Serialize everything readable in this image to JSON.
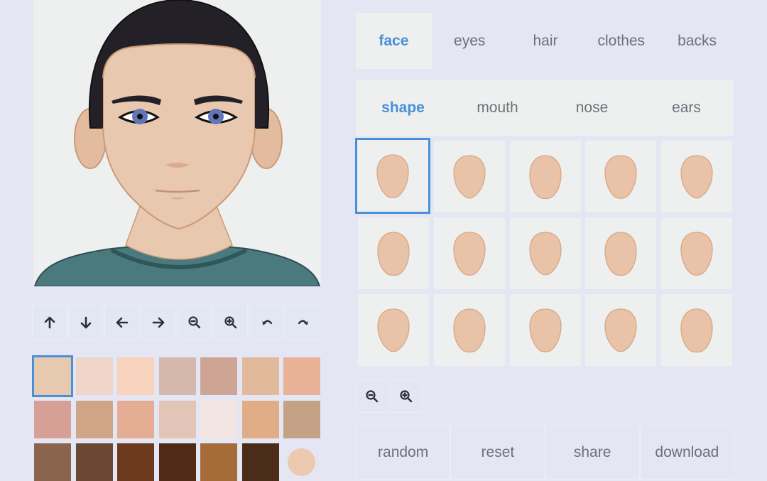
{
  "avatar": {
    "skin_color": "#e8c8ae",
    "hair_color": "#232027",
    "eye_color": "#6176b8",
    "shirt_color": "#4b7a7e",
    "background_color": "#eef0f0"
  },
  "toolbar": [
    {
      "name": "move-up",
      "icon": "arrow-up-icon"
    },
    {
      "name": "move-down",
      "icon": "arrow-down-icon"
    },
    {
      "name": "move-left",
      "icon": "arrow-left-icon"
    },
    {
      "name": "move-right",
      "icon": "arrow-right-icon"
    },
    {
      "name": "zoom-out",
      "icon": "zoom-out-icon"
    },
    {
      "name": "zoom-in",
      "icon": "zoom-in-icon"
    },
    {
      "name": "undo",
      "icon": "undo-icon"
    },
    {
      "name": "redo",
      "icon": "redo-icon"
    }
  ],
  "skin_swatches": {
    "selected_index": 0,
    "colors": [
      "#e7c9af",
      "#efd4ca",
      "#f7d2bc",
      "#d4b8ac",
      "#cea595",
      "#e0ba9a",
      "#e9b195",
      "#d6a097",
      "#cfa487",
      "#e6ad95",
      "#e3c5b8",
      "#f2e5e2",
      "#e1ad87",
      "#c4a286",
      "#8b644e",
      "#6c4734",
      "#6c3b1e",
      "#512a15",
      "#a56c3a",
      "#4a2c19",
      "#ebcab0"
    ]
  },
  "main_tabs": {
    "active_index": 0,
    "items": [
      "face",
      "eyes",
      "hair",
      "clothes",
      "backs"
    ]
  },
  "sub_tabs": {
    "active_index": 0,
    "items": [
      "shape",
      "mouth",
      "nose",
      "ears"
    ]
  },
  "shape_options": {
    "selected_index": 0,
    "count": 15,
    "fill_color": "#e8c3a8",
    "stroke_color": "#d6a787"
  },
  "grid_zoom": [
    {
      "name": "grid-zoom-out",
      "icon": "zoom-out-icon"
    },
    {
      "name": "grid-zoom-in",
      "icon": "zoom-in-icon"
    }
  ],
  "actions": {
    "random": "random",
    "reset": "reset",
    "share": "share",
    "download": "download"
  },
  "colors": {
    "accent": "#4a90d9",
    "page_bg": "#e4e6f3",
    "panel_bg": "#eef0f0",
    "text": "#6d7278"
  }
}
